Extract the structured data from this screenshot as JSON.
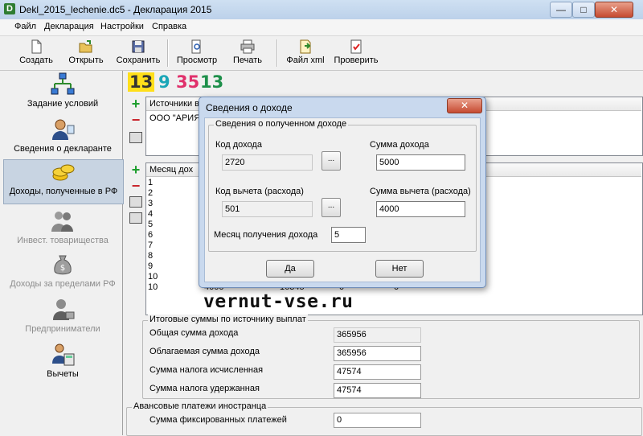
{
  "window": {
    "title": "Dekl_2015_lechenie.dc5 - Декларация 2015",
    "app_icon_letter": "D"
  },
  "menu": [
    "Файл",
    "Декларация",
    "Настройки",
    "Справка"
  ],
  "toolbar": {
    "create": "Создать",
    "open": "Открыть",
    "save": "Сохранить",
    "preview": "Просмотр",
    "print": "Печать",
    "xml": "Файл xml",
    "check": "Проверить"
  },
  "sidebar": [
    {
      "label": "Задание условий",
      "icon": "conditions-icon"
    },
    {
      "label": "Сведения о декларанте",
      "icon": "person-icon"
    },
    {
      "label": "Доходы, полученные в РФ",
      "icon": "coins-icon"
    },
    {
      "label": "Инвест. товарищества",
      "icon": "investors-icon"
    },
    {
      "label": "Доходы за пределами РФ",
      "icon": "money-bag-icon"
    },
    {
      "label": "Предприниматели",
      "icon": "entrepreneur-icon"
    },
    {
      "label": "Вычеты",
      "icon": "deductions-icon"
    }
  ],
  "status_numbers": [
    "13",
    "9",
    "35",
    "13"
  ],
  "sources": {
    "header": "Источники в",
    "rows": [
      "ООО \"АРИЯ\""
    ]
  },
  "months": {
    "header": "Месяц дох",
    "rows": [
      "1",
      "2",
      "3",
      "4",
      "5",
      "6",
      "7",
      "8",
      "9",
      "10",
      "10"
    ],
    "partial_row": {
      "col1": "4000",
      "col2": "16345",
      "col3": "0",
      "col4": "0"
    }
  },
  "totals": {
    "legend": "Итоговые суммы по источнику выплат",
    "total_income_label": "Общая сумма дохода",
    "total_income": "365956",
    "taxable_income_label": "Облагаемая сумма дохода",
    "taxable_income": "365956",
    "tax_calc_label": "Сумма налога исчисленная",
    "tax_calc": "47574",
    "tax_withheld_label": "Сумма налога удержанная",
    "tax_withheld": "47574"
  },
  "advance": {
    "legend": "Авансовые платежи иностранца",
    "fixed_label": "Сумма фиксированных платежей",
    "fixed": "0"
  },
  "watermark": "vernut-vse.ru",
  "dialog": {
    "title": "Сведения о доходе",
    "group_legend": "Сведения о полученном доходе",
    "income_code_label": "Код дохода",
    "income_code": "2720",
    "income_sum_label": "Сумма дохода",
    "income_sum": "5000",
    "deduction_code_label": "Код вычета (расхода)",
    "deduction_code": "501",
    "deduction_sum_label": "Сумма вычета (расхода)",
    "deduction_sum": "4000",
    "month_label": "Месяц получения дохода",
    "month": "5",
    "ellipsis": "...",
    "yes": "Да",
    "no": "Нет"
  }
}
